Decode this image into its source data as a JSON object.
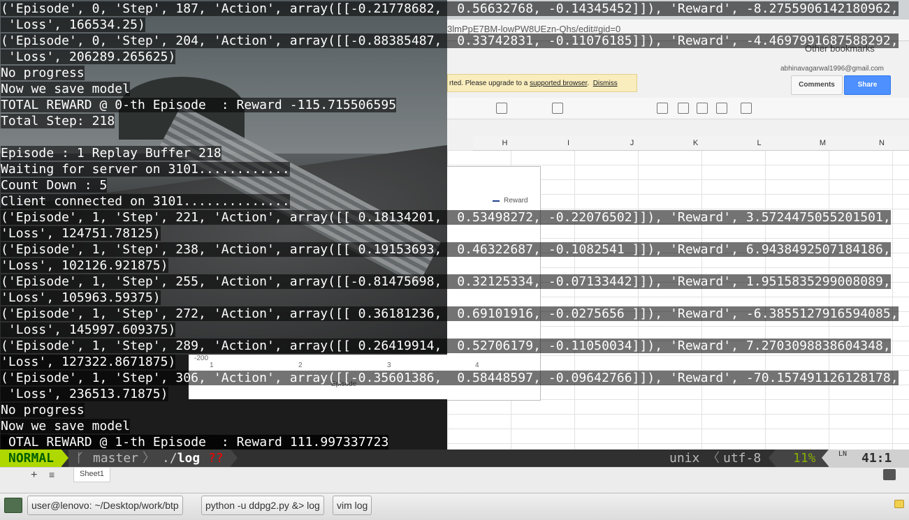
{
  "terminal": {
    "lines": [
      "('Episode', 0, 'Step', 187, 'Action', array([[-0.21778682,  0.56632768, -0.14345452]]), 'Reward', -8.2755906142180962,",
      " 'Loss', 166534.25)",
      "('Episode', 0, 'Step', 204, 'Action', array([[-0.88385487,  0.33742831, -0.11076185]]), 'Reward', -4.4697991687588292,",
      " 'Loss', 206289.265625)",
      "No progress",
      "Now we save model",
      "TOTAL REWARD @ 0-th Episode  : Reward -115.715506595",
      "Total Step: 218",
      "",
      "Episode : 1 Replay Buffer 218",
      "Waiting for server on 3101............",
      "Count Down : 5",
      "Client connected on 3101..............",
      "('Episode', 1, 'Step', 221, 'Action', array([[ 0.18134201,  0.53498272, -0.22076502]]), 'Reward', 3.5724475055201501,",
      "'Loss', 124751.78125)",
      "('Episode', 1, 'Step', 238, 'Action', array([[ 0.19153693,  0.46322687, -0.1082541 ]]), 'Reward', 6.9438492507184186,",
      "'Loss', 102126.921875)",
      "('Episode', 1, 'Step', 255, 'Action', array([[-0.81475698,  0.32125334, -0.07133442]]), 'Reward', 1.9515835299008089,",
      "'Loss', 105963.59375)",
      "('Episode', 1, 'Step', 272, 'Action', array([[ 0.36181236,  0.69101916, -0.0275656 ]]), 'Reward', -6.3855127916594085,",
      " 'Loss', 145997.609375)",
      "('Episode', 1, 'Step', 289, 'Action', array([[ 0.26419914,  0.52706179, -0.11050034]]), 'Reward', 7.2703098838604348,",
      "'Loss', 127322.8671875)",
      "('Episode', 1, 'Step', 306, 'Action', array([[-0.35601386,  0.58448597, -0.09642766]]), 'Reward', -70.157491126128178,",
      " 'Loss', 236513.71875)",
      "No progress",
      "Now we save model",
      "TOTAL REWARD @ 1-th Episode  : Reward 111.997337723"
    ]
  },
  "statusline": {
    "mode": "NORMAL",
    "branch_icon": "ᚴ",
    "branch": "master",
    "separator": "〉",
    "path_prefix": "./",
    "file": "log",
    "modified": "??",
    "fileformat": "unix",
    "separator2": "〈",
    "encoding": "utf-8",
    "percent": "11%",
    "line_icon": "LN",
    "position": "41:1"
  },
  "browser": {
    "url_fragment": "3lmPpE7BM-lowPW8UEzn-Qhs/edit#gid=0",
    "bookmarks": "Other bookmarks",
    "account": "abhinavagarwal1996@gmail.com",
    "warning": "rted. Please upgrade to a ",
    "warning_link": "supported browser",
    "warning_dismiss": "Dismiss",
    "comments": "Comments",
    "share": "Share",
    "columns": [
      "H",
      "I",
      "J",
      "K",
      "L",
      "M",
      "N"
    ],
    "chart_legend": "Reward",
    "sheet_tab": "Sheet1"
  },
  "chart_under": {
    "y_label": "-200",
    "x_ticks": [
      "1",
      "2",
      "3",
      "4"
    ],
    "x_label": "Episode"
  },
  "taskbar": {
    "tasks": [
      "user@lenovo: ~/Desktop/work/btp",
      "python -u ddpg2.py &> log",
      "vim log"
    ]
  }
}
